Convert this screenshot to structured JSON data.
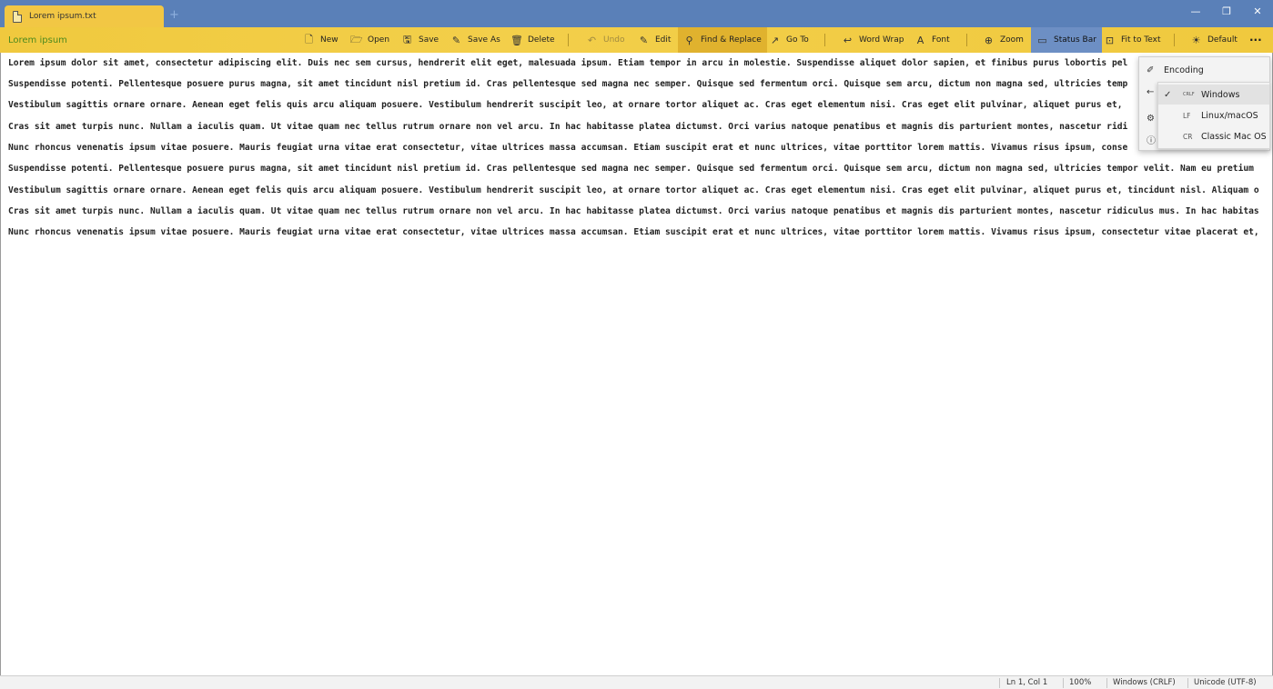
{
  "tab": {
    "title": "Lorem ipsum.txt",
    "new_tab": "+"
  },
  "window": {
    "minimize": "—",
    "restore": "❐",
    "close": "✕"
  },
  "toolbar": {
    "doc_title": "Lorem ipsum",
    "new": "New",
    "open": "Open",
    "save": "Save",
    "save_as": "Save As",
    "delete": "Delete",
    "undo": "Undo",
    "edit": "Edit",
    "find_replace": "Find & Replace",
    "go_to": "Go To",
    "word_wrap": "Word Wrap",
    "font": "Font",
    "zoom": "Zoom",
    "status_bar": "Status Bar",
    "fit_to_text": "Fit to Text",
    "default_theme": "Default",
    "more": "···"
  },
  "editor": {
    "lines": [
      "Lorem ipsum dolor sit amet, consectetur adipiscing elit. Duis nec sem cursus, hendrerit elit eget, malesuada ipsum. Etiam tempor in arcu in molestie. Suspendisse aliquet dolor sapien, et finibus purus lobortis pel",
      "Suspendisse potenti. Pellentesque posuere purus magna, sit amet tincidunt nisl pretium id. Cras pellentesque sed magna nec semper. Quisque sed fermentum orci. Quisque sem arcu, dictum non magna sed, ultricies temp",
      "Vestibulum sagittis ornare ornare. Aenean eget felis quis arcu aliquam posuere. Vestibulum hendrerit suscipit leo, at ornare tortor aliquet ac. Cras eget elementum nisi. Cras eget elit pulvinar, aliquet purus et,",
      "Cras sit amet turpis nunc. Nullam a iaculis quam. Ut vitae quam nec tellus rutrum ornare non vel arcu. In hac habitasse platea dictumst. Orci varius natoque penatibus et magnis dis parturient montes, nascetur ridi",
      "Nunc rhoncus venenatis ipsum vitae posuere. Mauris feugiat urna vitae erat consectetur, vitae ultrices massa accumsan. Etiam suscipit erat et nunc ultrices, vitae porttitor lorem mattis. Vivamus risus ipsum, conse",
      "Suspendisse potenti. Pellentesque posuere purus magna, sit amet tincidunt nisl pretium id. Cras pellentesque sed magna nec semper. Quisque sed fermentum orci. Quisque sem arcu, dictum non magna sed, ultricies tempor velit. Nam eu pretium",
      "Vestibulum sagittis ornare ornare. Aenean eget felis quis arcu aliquam posuere. Vestibulum hendrerit suscipit leo, at ornare tortor aliquet ac. Cras eget elementum nisi. Cras eget elit pulvinar, aliquet purus et, tincidunt nisl. Aliquam o",
      "Cras sit amet turpis nunc. Nullam a iaculis quam. Ut vitae quam nec tellus rutrum ornare non vel arcu. In hac habitasse platea dictumst. Orci varius natoque penatibus et magnis dis parturient montes, nascetur ridiculus mus. In hac habitas",
      "Nunc rhoncus venenatis ipsum vitae posuere. Mauris feugiat urna vitae erat consectetur, vitae ultrices massa accumsan. Etiam suscipit erat et nunc ultrices, vitae porttitor lorem mattis. Vivamus risus ipsum, consectetur vitae placerat et,"
    ]
  },
  "menu": {
    "encoding": "Encoding",
    "line_endings": [
      {
        "code": "CRLF",
        "label": "Windows",
        "checked": "✓"
      },
      {
        "code": "LF",
        "label": "Linux/macOS"
      },
      {
        "code": "CR",
        "label": "Classic Mac OS"
      }
    ]
  },
  "statusbar": {
    "position": "Ln 1, Col 1",
    "zoom": "100%",
    "line_ending": "Windows (CRLF)",
    "encoding": "Unicode (UTF-8)"
  }
}
